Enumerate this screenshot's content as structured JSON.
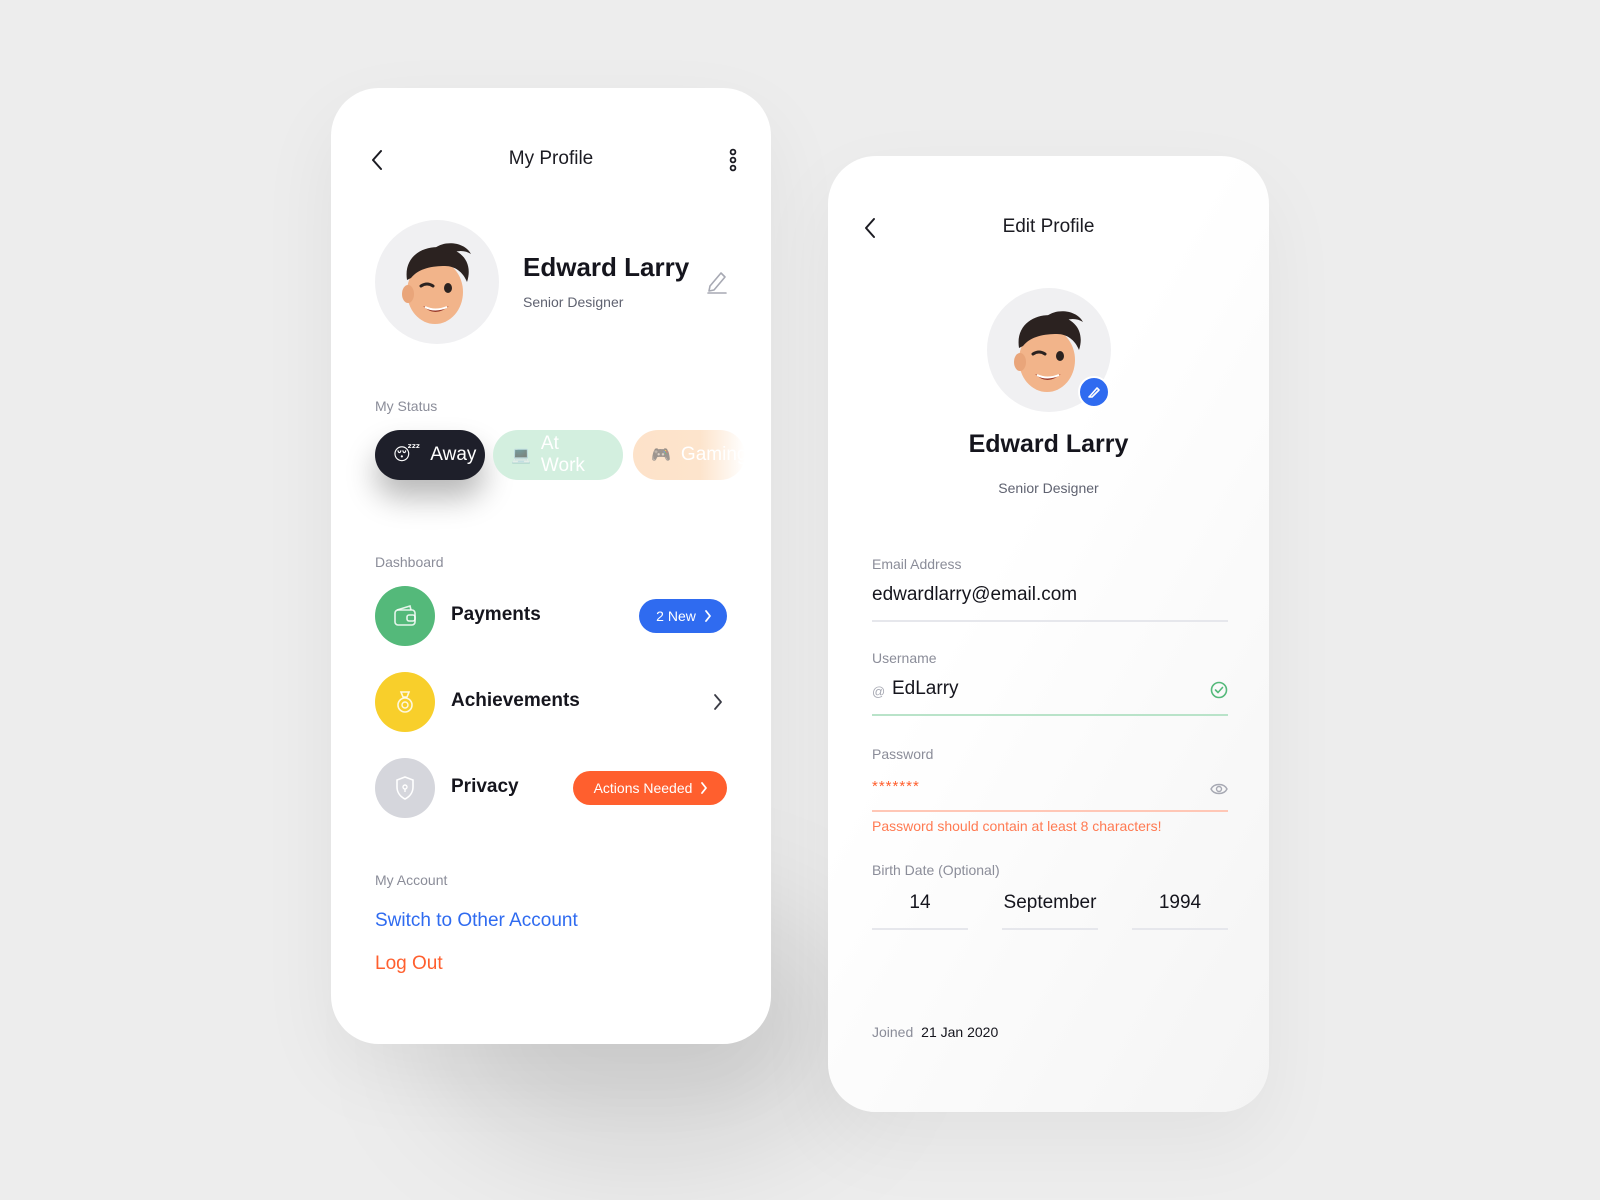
{
  "profile_screen": {
    "title": "My Profile",
    "user": {
      "name": "Edward Larry",
      "role": "Senior Designer"
    },
    "status": {
      "label": "My Status",
      "chips": [
        {
          "emoji": "😴",
          "label": "Away"
        },
        {
          "emoji": "💻",
          "label": "At Work"
        },
        {
          "emoji": "🎮",
          "label": "Gaming"
        }
      ]
    },
    "dashboard": {
      "label": "Dashboard",
      "items": [
        {
          "label": "Payments",
          "badge": "2 New",
          "icon": "wallet-icon",
          "color": "#54b97a"
        },
        {
          "label": "Achievements",
          "badge": "",
          "icon": "medal-icon",
          "color": "#f8cf2b"
        },
        {
          "label": "Privacy",
          "badge": "Actions Needed",
          "icon": "shield-icon",
          "color": "#d5d6dc"
        }
      ]
    },
    "account": {
      "label": "My Account",
      "switch_label": "Switch to Other Account",
      "logout_label": "Log Out"
    }
  },
  "edit_screen": {
    "title": "Edit Profile",
    "user": {
      "name": "Edward Larry",
      "role": "Senior Designer"
    },
    "email": {
      "label": "Email Address",
      "value": "edwardlarry@email.com"
    },
    "username": {
      "label": "Username",
      "prefix": "@",
      "value": "EdLarry"
    },
    "password": {
      "label": "Password",
      "value": "*******",
      "error": "Password should contain at least 8 characters!"
    },
    "birthdate": {
      "label": "Birth Date (Optional)",
      "day": "14",
      "month": "September",
      "year": "1994"
    },
    "joined": {
      "label": "Joined",
      "date": "21 Jan 2020"
    }
  },
  "colors": {
    "blue": "#2f6bf0",
    "orange": "#ff5f2e",
    "green": "#54b97a",
    "yellow": "#f8cf2b",
    "dark": "#1e1f2a"
  }
}
